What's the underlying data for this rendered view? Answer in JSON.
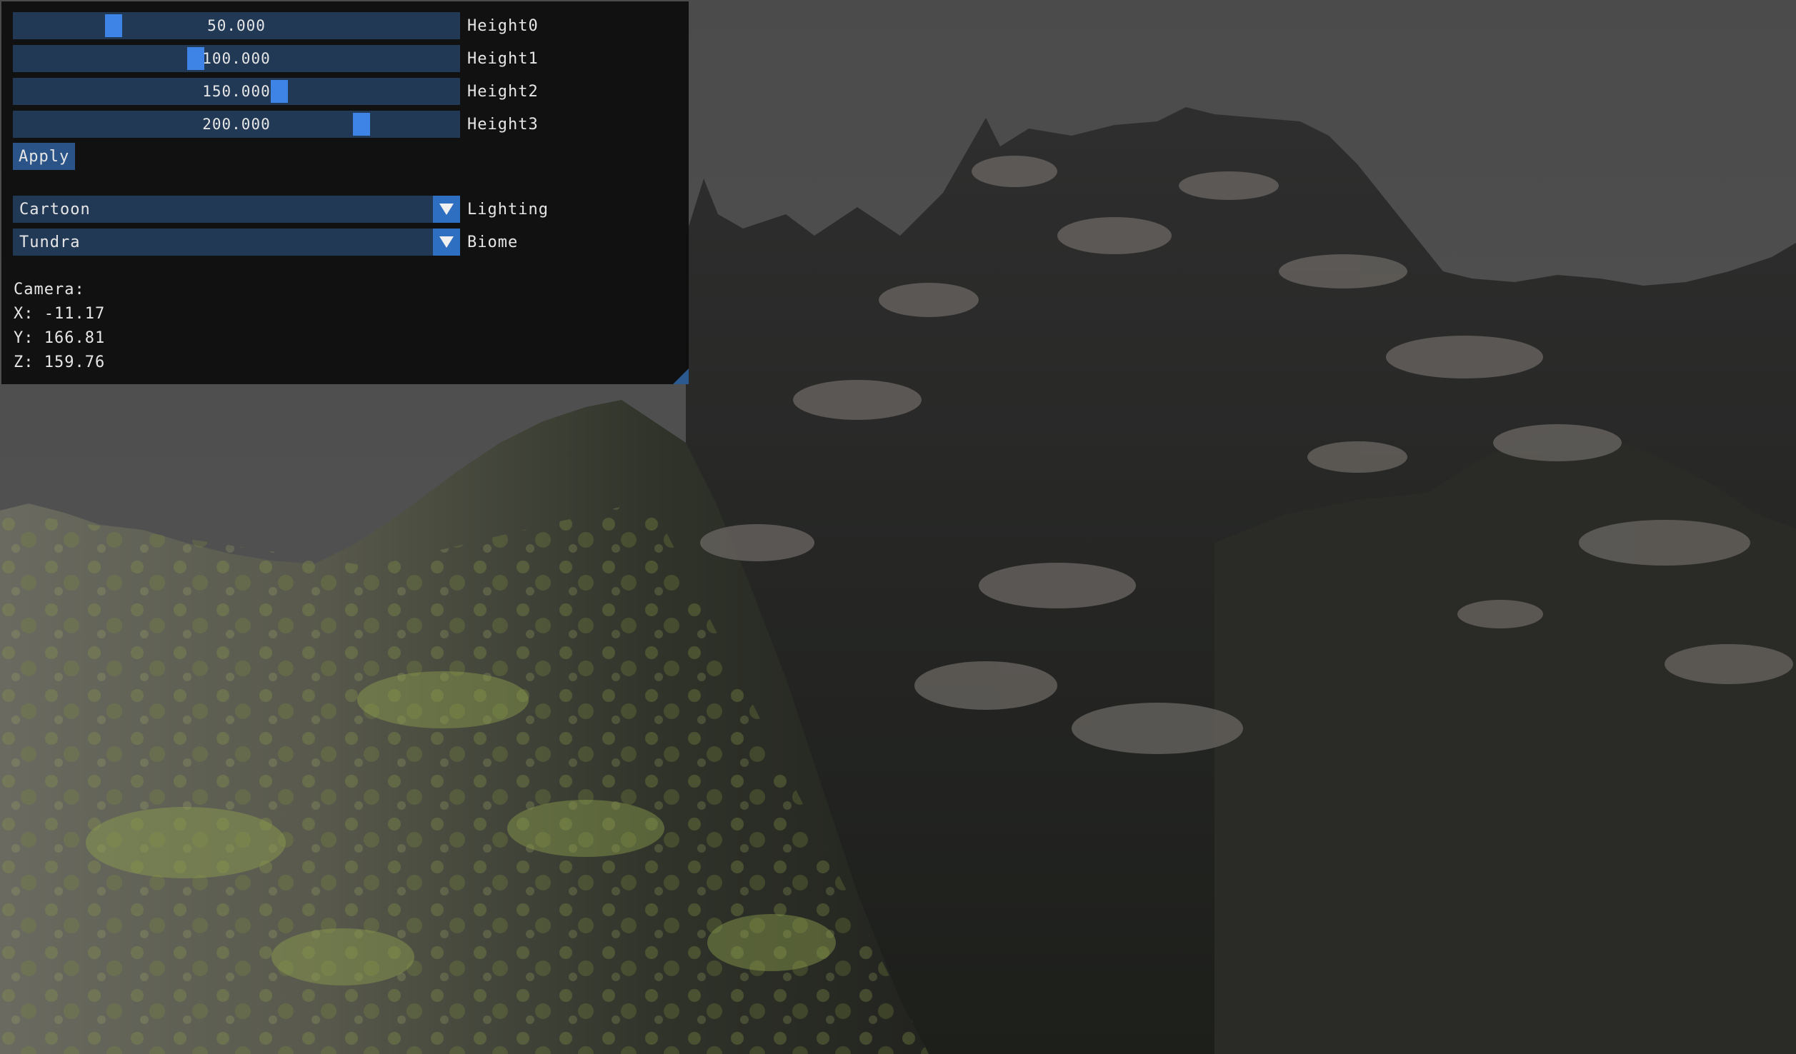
{
  "sliders": [
    {
      "label": "Height0",
      "display": "50.000",
      "position": 0.215
    },
    {
      "label": "Height1",
      "display": "100.000",
      "position": 0.405
    },
    {
      "label": "Height2",
      "display": "150.000",
      "position": 0.6
    },
    {
      "label": "Height3",
      "display": "200.000",
      "position": 0.79
    }
  ],
  "apply_label": "Apply",
  "lighting": {
    "value": "Cartoon",
    "label": "Lighting"
  },
  "biome": {
    "value": "Tundra",
    "label": "Biome"
  },
  "camera": {
    "heading": "Camera:",
    "x": "X: -11.17",
    "y": "Y: 166.81",
    "z": "Z: 159.76"
  },
  "colors": {
    "panel_bg": "#0f0f0f",
    "frame_bg": "#213955",
    "grab": "#3d84e6",
    "button": "#2a5487",
    "sky": "#4d4d4d"
  }
}
